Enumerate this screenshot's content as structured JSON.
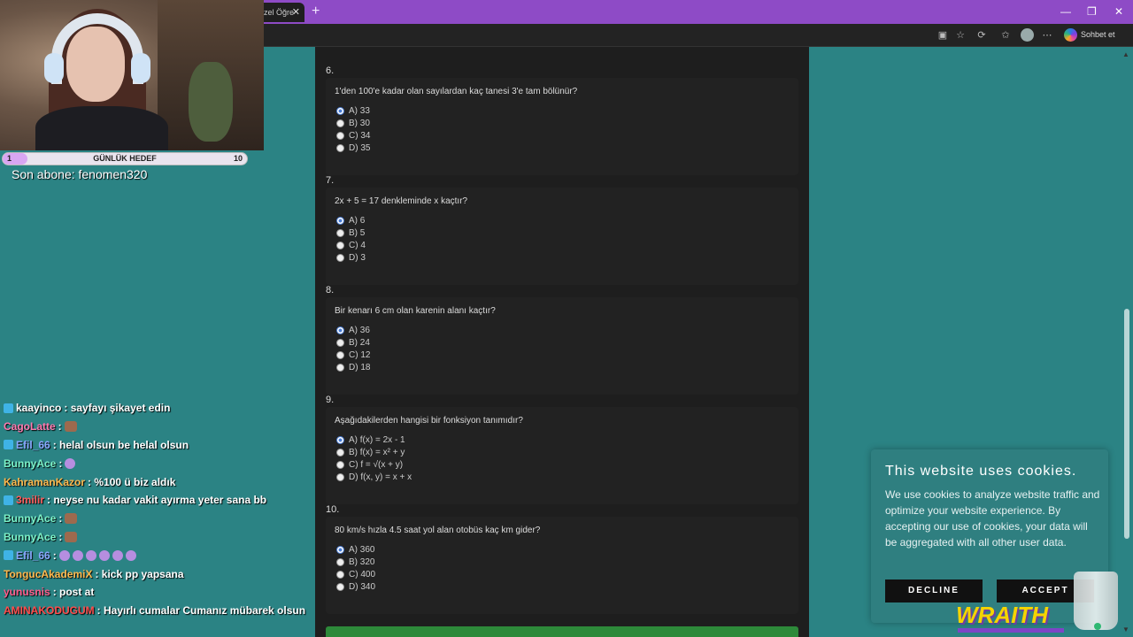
{
  "browser": {
    "tab_title": "zel Öğre",
    "tab_close": "✕",
    "new_tab": "+",
    "window_controls": [
      "—",
      "❐",
      "✕"
    ],
    "toolbar_icons": [
      "split-screen-icon",
      "favorite-star-icon",
      "extensions-icon",
      "favorites-icon",
      "profile-icon",
      "more-icon"
    ],
    "copilot_label": "Sohbet et"
  },
  "overlay": {
    "goal_title": "GÜNLÜK HEDEF",
    "goal_min": "1",
    "goal_max": "10",
    "goal_progress": 0.1,
    "last_sub": "Son abone: fenomen320",
    "chat": [
      {
        "user": "kaayinco",
        "user_color": "#ffffff",
        "message": ": sayfayı şikayet edin"
      },
      {
        "user": "CagoLatte",
        "user_color": "#ff7ab0",
        "message": ":"
      },
      {
        "user": "Efil_66",
        "user_color": "#8aa7ff",
        "message": ": helal olsun be helal olsun"
      },
      {
        "user": "BunnyAce",
        "user_color": "#7cf2c8",
        "message": ":"
      },
      {
        "user": "KahramanKazor",
        "user_color": "#ffb84d",
        "message": ": %100 ü biz aldık"
      },
      {
        "user": "3milir",
        "user_color": "#ff5b5b",
        "message": ": neyse nu kadar vakit ayırma yeter sana bb"
      },
      {
        "user": "BunnyAce",
        "user_color": "#7cf2c8",
        "message": ":"
      },
      {
        "user": "BunnyAce",
        "user_color": "#7cf2c8",
        "message": ":"
      },
      {
        "user": "Efil_66",
        "user_color": "#8aa7ff",
        "message": ":"
      },
      {
        "user": "TongucAkademiX",
        "user_color": "#ffb84d",
        "message": ": kick pp yapsana"
      },
      {
        "user": "yunusnis",
        "user_color": "#ff5b8a",
        "message": ": post at"
      },
      {
        "user": "AMINAKODUGUM",
        "user_color": "#ff4d4d",
        "message": ": Hayırlı cumalar Cumanız mübarek olsun"
      }
    ]
  },
  "quiz": {
    "questions": [
      {
        "number": "6.",
        "text": "1'den 100'e kadar olan sayılardan kaç tanesi 3'e tam bölünür?",
        "options": [
          "A) 33",
          "B) 30",
          "C) 34",
          "D) 35"
        ],
        "selected": 0
      },
      {
        "number": "7.",
        "text": "2x + 5 = 17 denkleminde x kaçtır?",
        "options": [
          "A) 6",
          "B) 5",
          "C) 4",
          "D) 3"
        ],
        "selected": 0
      },
      {
        "number": "8.",
        "text": "Bir kenarı 6 cm olan karenin alanı kaçtır?",
        "options": [
          "A) 36",
          "B) 24",
          "C) 12",
          "D) 18"
        ],
        "selected": 0
      },
      {
        "number": "9.",
        "text": "Aşağıdakilerden hangisi bir fonksiyon tanımıdır?",
        "options": [
          "A) f(x) = 2x - 1",
          "B) f(x) = x² + y",
          "C) f = √(x + y)",
          "D) f(x, y) = x + x"
        ],
        "selected": 0
      },
      {
        "number": "10.",
        "text": "80 km/s hızla 4.5 saat yol alan otobüs kaç km gider?",
        "options": [
          "A) 360",
          "B) 320",
          "C) 400",
          "D) 340"
        ],
        "selected": 0
      }
    ]
  },
  "cookie": {
    "title": "This website uses cookies.",
    "text": "We use cookies to analyze website traffic and optimize your website experience. By accepting our use of cookies, your data will be aggregated with all other user data.",
    "decline_label": "DECLINE",
    "accept_label": "ACCEPT"
  },
  "brand": {
    "logo_text": "WRAITH",
    "accent": "#f5d400"
  },
  "colors": {
    "browser_frame": "#8e4bc6",
    "background": "#2b8384",
    "page": "#1e1e1e",
    "radio_selected": "#4a7dd4"
  }
}
